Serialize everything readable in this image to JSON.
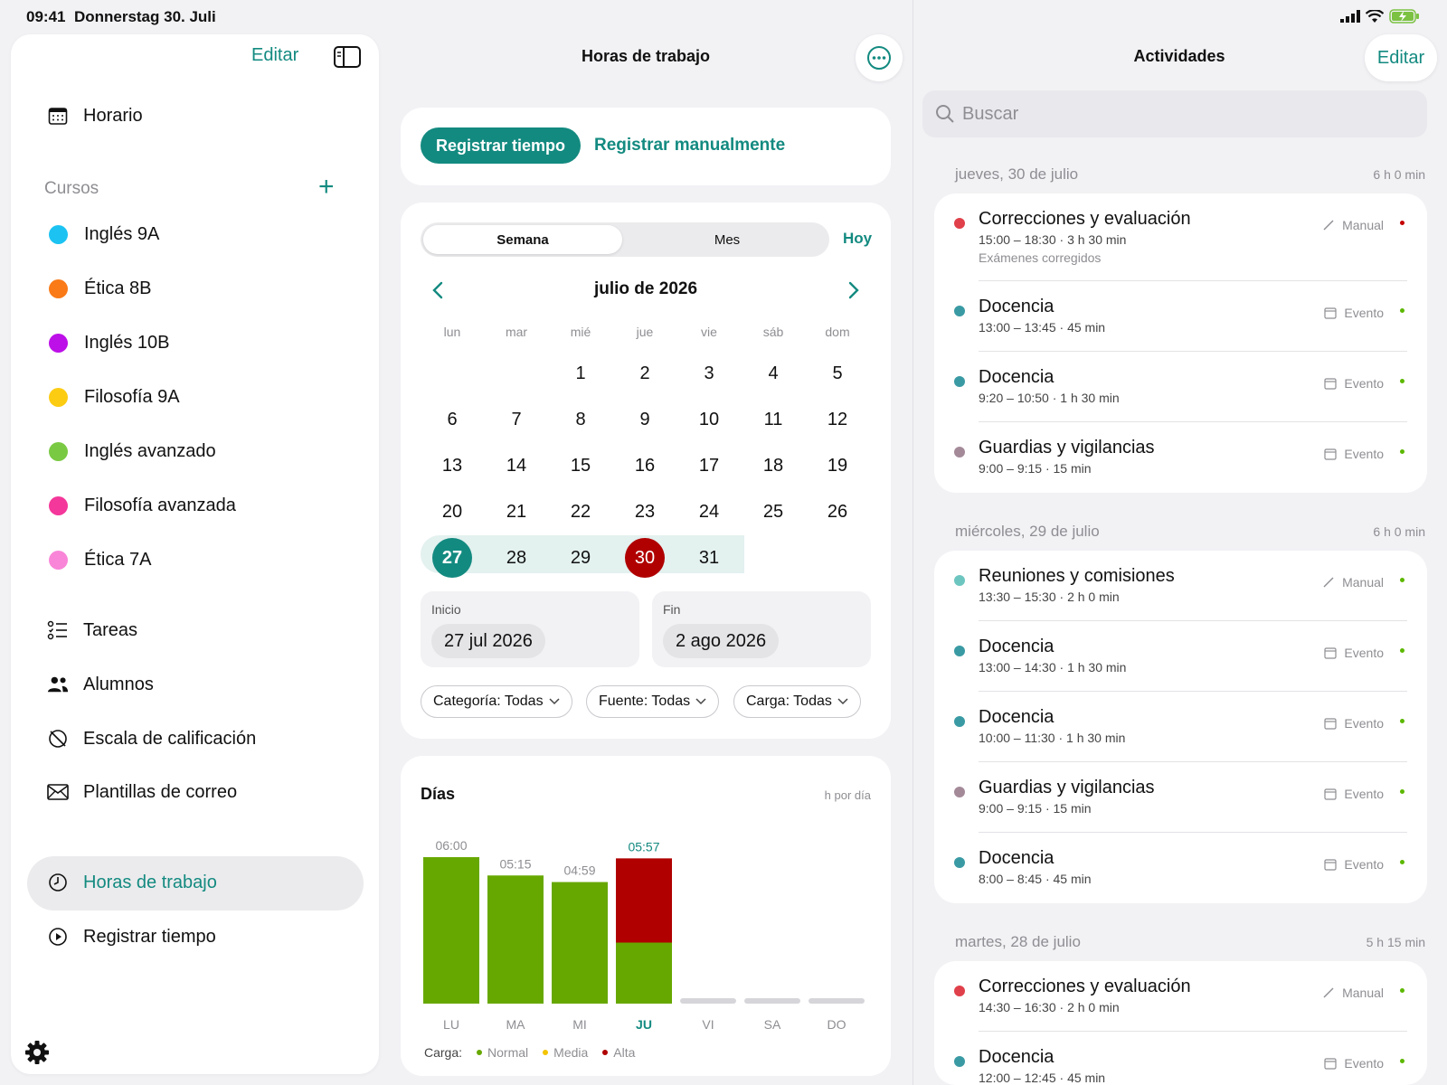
{
  "status": {
    "time": "09:41",
    "date": "Donnerstag 30. Juli"
  },
  "sidebar": {
    "edit_label": "Editar",
    "schedule": "Horario",
    "courses_title": "Cursos",
    "courses": [
      {
        "name": "Inglés 9A",
        "color": "#1cc3f2"
      },
      {
        "name": "Ética 8B",
        "color": "#f97a17"
      },
      {
        "name": "Inglés 10B",
        "color": "#bd10e8"
      },
      {
        "name": "Filosofía 9A",
        "color": "#fccc13"
      },
      {
        "name": "Inglés avanzado",
        "color": "#7ac943"
      },
      {
        "name": "Filosofía avanzada",
        "color": "#f4379a"
      },
      {
        "name": "Ética 7A",
        "color": "#f985d8"
      }
    ],
    "items": [
      {
        "label": "Tareas"
      },
      {
        "label": "Alumnos"
      },
      {
        "label": "Escala de calificación"
      },
      {
        "label": "Plantillas de correo"
      }
    ],
    "work_hours": "Horas de trabajo",
    "track_time": "Registrar tiempo"
  },
  "middle": {
    "title": "Horas de trabajo",
    "primary_button": "Registrar tiempo",
    "link_button": "Registrar manualmente",
    "segments": [
      "Semana",
      "Mes"
    ],
    "today": "Hoy",
    "month_title": "julio de 2026",
    "weekdays": [
      "lun",
      "mar",
      "mié",
      "jue",
      "vie",
      "sáb",
      "dom"
    ],
    "weeks": [
      [
        "",
        "",
        "1",
        "2",
        "3",
        "4",
        "5"
      ],
      [
        "6",
        "7",
        "8",
        "9",
        "10",
        "11",
        "12"
      ],
      [
        "13",
        "14",
        "15",
        "16",
        "17",
        "18",
        "19"
      ],
      [
        "20",
        "21",
        "22",
        "23",
        "24",
        "25",
        "26"
      ],
      [
        "27",
        "28",
        "29",
        "30",
        "31",
        "",
        ""
      ]
    ],
    "start_label": "Inicio",
    "start_value": "27 jul 2026",
    "end_label": "Fin",
    "end_value": "2 ago 2026",
    "filters": [
      "Categoría: Todas",
      "Fuente: Todas",
      "Carga: Todas"
    ],
    "chart_title": "Días",
    "chart_unit": "h por día",
    "legend_label": "Carga:",
    "legend": [
      {
        "name": "Normal",
        "color": "#67a800"
      },
      {
        "name": "Media",
        "color": "#f3c400"
      },
      {
        "name": "Alta",
        "color": "#b00000"
      }
    ]
  },
  "chart_data": {
    "type": "bar",
    "title": "Días",
    "ylabel": "h por día",
    "categories": [
      "LU",
      "MA",
      "MI",
      "JU",
      "VI",
      "SA",
      "DO"
    ],
    "value_labels": [
      "06:00",
      "05:15",
      "04:59",
      "05:57",
      "",
      "",
      ""
    ],
    "series": [
      {
        "name": "Normal",
        "values": [
          6.0,
          5.25,
          4.98,
          2.5,
          0,
          0,
          0
        ],
        "color": "#67a800"
      },
      {
        "name": "Alta",
        "values": [
          0,
          0,
          0,
          3.45,
          0,
          0,
          0
        ],
        "color": "#b00000"
      }
    ],
    "highlight": "JU",
    "ylim": [
      0,
      6
    ]
  },
  "right": {
    "title": "Actividades",
    "edit_label": "Editar",
    "search_placeholder": "Buscar",
    "groups": [
      {
        "date": "jueves, 30 de julio",
        "total": "6 h 0 min",
        "items": [
          {
            "name": "Correcciones y evaluación",
            "time": "15:00 – 18:30 · 3 h 30 min",
            "note": "Exámenes corregidos",
            "source": "Manual",
            "color": "#e0404a",
            "status": "#c40000"
          },
          {
            "name": "Docencia",
            "time": "13:00 – 13:45 · 45 min",
            "source": "Evento",
            "color": "#3a9aa3",
            "status": "#5cb800"
          },
          {
            "name": "Docencia",
            "time": "9:20 – 10:50 · 1 h 30 min",
            "source": "Evento",
            "color": "#3a9aa3",
            "status": "#5cb800"
          },
          {
            "name": "Guardias y vigilancias",
            "time": "9:00 – 9:15 · 15 min",
            "source": "Evento",
            "color": "#a48a99",
            "status": "#5cb800"
          }
        ]
      },
      {
        "date": "miércoles, 29 de julio",
        "total": "6 h 0 min",
        "items": [
          {
            "name": "Reuniones y comisiones",
            "time": "13:30 – 15:30 · 2 h 0 min",
            "source": "Manual",
            "color": "#6dc5c0",
            "status": "#5cb800"
          },
          {
            "name": "Docencia",
            "time": "13:00 – 14:30 · 1 h 30 min",
            "source": "Evento",
            "color": "#3a9aa3",
            "status": "#5cb800"
          },
          {
            "name": "Docencia",
            "time": "10:00 – 11:30 · 1 h 30 min",
            "source": "Evento",
            "color": "#3a9aa3",
            "status": "#5cb800"
          },
          {
            "name": "Guardias y vigilancias",
            "time": "9:00 – 9:15 · 15 min",
            "source": "Evento",
            "color": "#a48a99",
            "status": "#5cb800"
          },
          {
            "name": "Docencia",
            "time": "8:00 – 8:45 · 45 min",
            "source": "Evento",
            "color": "#3a9aa3",
            "status": "#5cb800"
          }
        ]
      },
      {
        "date": "martes, 28 de julio",
        "total": "5 h 15 min",
        "items": [
          {
            "name": "Correcciones y evaluación",
            "time": "14:30 – 16:30 · 2 h 0 min",
            "source": "Manual",
            "color": "#e0404a",
            "status": "#5cb800"
          },
          {
            "name": "Docencia",
            "time": "12:00 – 12:45 · 45 min",
            "source": "Evento",
            "color": "#3a9aa3",
            "status": "#5cb800"
          }
        ]
      }
    ]
  }
}
